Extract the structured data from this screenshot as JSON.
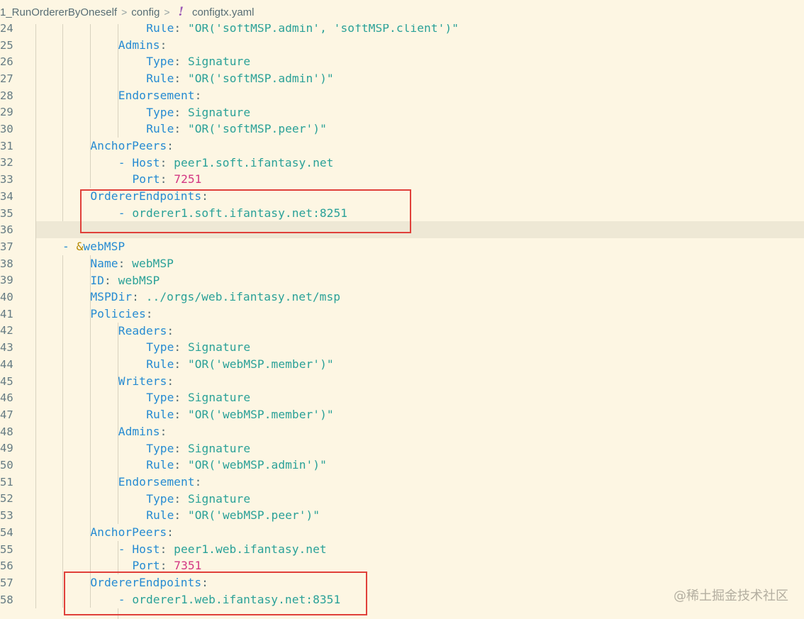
{
  "breadcrumb": {
    "folder": "1_RunOrdererByOneself",
    "subfolder": "config",
    "file_icon": "!",
    "file": "configtx.yaml"
  },
  "lines": [
    {
      "num": "24",
      "indent": 4,
      "tokens": [
        {
          "t": "k",
          "v": "Rule"
        },
        {
          "t": "p",
          "v": ": "
        },
        {
          "t": "s",
          "v": "\"OR('softMSP.admin', 'softMSP.client')\""
        }
      ]
    },
    {
      "num": "25",
      "indent": 3,
      "tokens": [
        {
          "t": "k",
          "v": "Admins"
        },
        {
          "t": "p",
          "v": ":"
        }
      ]
    },
    {
      "num": "26",
      "indent": 4,
      "tokens": [
        {
          "t": "k",
          "v": "Type"
        },
        {
          "t": "p",
          "v": ": "
        },
        {
          "t": "s",
          "v": "Signature"
        }
      ]
    },
    {
      "num": "27",
      "indent": 4,
      "tokens": [
        {
          "t": "k",
          "v": "Rule"
        },
        {
          "t": "p",
          "v": ": "
        },
        {
          "t": "s",
          "v": "\"OR('softMSP.admin')\""
        }
      ]
    },
    {
      "num": "28",
      "indent": 3,
      "tokens": [
        {
          "t": "k",
          "v": "Endorsement"
        },
        {
          "t": "p",
          "v": ":"
        }
      ]
    },
    {
      "num": "29",
      "indent": 4,
      "tokens": [
        {
          "t": "k",
          "v": "Type"
        },
        {
          "t": "p",
          "v": ": "
        },
        {
          "t": "s",
          "v": "Signature"
        }
      ]
    },
    {
      "num": "30",
      "indent": 4,
      "tokens": [
        {
          "t": "k",
          "v": "Rule"
        },
        {
          "t": "p",
          "v": ": "
        },
        {
          "t": "s",
          "v": "\"OR('softMSP.peer')\""
        }
      ]
    },
    {
      "num": "31",
      "indent": 2,
      "tokens": [
        {
          "t": "k",
          "v": "AnchorPeers"
        },
        {
          "t": "p",
          "v": ":"
        }
      ]
    },
    {
      "num": "32",
      "indent": 3,
      "tokens": [
        {
          "t": "k",
          "v": "- Host"
        },
        {
          "t": "p",
          "v": ": "
        },
        {
          "t": "s",
          "v": "peer1.soft.ifantasy.net"
        }
      ]
    },
    {
      "num": "33",
      "indent": 3.5,
      "tokens": [
        {
          "t": "k",
          "v": "Port"
        },
        {
          "t": "p",
          "v": ": "
        },
        {
          "t": "n",
          "v": "7251"
        }
      ]
    },
    {
      "num": "34",
      "indent": 2,
      "tokens": [
        {
          "t": "k",
          "v": "OrdererEndpoints"
        },
        {
          "t": "p",
          "v": ":"
        }
      ]
    },
    {
      "num": "35",
      "indent": 3,
      "tokens": [
        {
          "t": "k",
          "v": "- "
        },
        {
          "t": "s",
          "v": "orderer1.soft.ifantasy.net:8251"
        }
      ]
    },
    {
      "num": "36",
      "indent": 0,
      "tokens": []
    },
    {
      "num": "37",
      "indent": 1,
      "tokens": [
        {
          "t": "k",
          "v": "- "
        },
        {
          "t": "a",
          "v": "&"
        },
        {
          "t": "k",
          "v": "webMSP"
        }
      ]
    },
    {
      "num": "38",
      "indent": 2,
      "tokens": [
        {
          "t": "k",
          "v": "Name"
        },
        {
          "t": "p",
          "v": ": "
        },
        {
          "t": "s",
          "v": "webMSP"
        }
      ]
    },
    {
      "num": "39",
      "indent": 2,
      "tokens": [
        {
          "t": "k",
          "v": "ID"
        },
        {
          "t": "p",
          "v": ": "
        },
        {
          "t": "s",
          "v": "webMSP"
        }
      ]
    },
    {
      "num": "40",
      "indent": 2,
      "tokens": [
        {
          "t": "k",
          "v": "MSPDir"
        },
        {
          "t": "p",
          "v": ": "
        },
        {
          "t": "s",
          "v": "../orgs/web.ifantasy.net/msp"
        }
      ]
    },
    {
      "num": "41",
      "indent": 2,
      "tokens": [
        {
          "t": "k",
          "v": "Policies"
        },
        {
          "t": "p",
          "v": ":"
        }
      ]
    },
    {
      "num": "42",
      "indent": 3,
      "tokens": [
        {
          "t": "k",
          "v": "Readers"
        },
        {
          "t": "p",
          "v": ":"
        }
      ]
    },
    {
      "num": "43",
      "indent": 4,
      "tokens": [
        {
          "t": "k",
          "v": "Type"
        },
        {
          "t": "p",
          "v": ": "
        },
        {
          "t": "s",
          "v": "Signature"
        }
      ]
    },
    {
      "num": "44",
      "indent": 4,
      "tokens": [
        {
          "t": "k",
          "v": "Rule"
        },
        {
          "t": "p",
          "v": ": "
        },
        {
          "t": "s",
          "v": "\"OR('webMSP.member')\""
        }
      ]
    },
    {
      "num": "45",
      "indent": 3,
      "tokens": [
        {
          "t": "k",
          "v": "Writers"
        },
        {
          "t": "p",
          "v": ":"
        }
      ]
    },
    {
      "num": "46",
      "indent": 4,
      "tokens": [
        {
          "t": "k",
          "v": "Type"
        },
        {
          "t": "p",
          "v": ": "
        },
        {
          "t": "s",
          "v": "Signature"
        }
      ]
    },
    {
      "num": "47",
      "indent": 4,
      "tokens": [
        {
          "t": "k",
          "v": "Rule"
        },
        {
          "t": "p",
          "v": ": "
        },
        {
          "t": "s",
          "v": "\"OR('webMSP.member')\""
        }
      ]
    },
    {
      "num": "48",
      "indent": 3,
      "tokens": [
        {
          "t": "k",
          "v": "Admins"
        },
        {
          "t": "p",
          "v": ":"
        }
      ]
    },
    {
      "num": "49",
      "indent": 4,
      "tokens": [
        {
          "t": "k",
          "v": "Type"
        },
        {
          "t": "p",
          "v": ": "
        },
        {
          "t": "s",
          "v": "Signature"
        }
      ]
    },
    {
      "num": "50",
      "indent": 4,
      "tokens": [
        {
          "t": "k",
          "v": "Rule"
        },
        {
          "t": "p",
          "v": ": "
        },
        {
          "t": "s",
          "v": "\"OR('webMSP.admin')\""
        }
      ]
    },
    {
      "num": "51",
      "indent": 3,
      "tokens": [
        {
          "t": "k",
          "v": "Endorsement"
        },
        {
          "t": "p",
          "v": ":"
        }
      ]
    },
    {
      "num": "52",
      "indent": 4,
      "tokens": [
        {
          "t": "k",
          "v": "Type"
        },
        {
          "t": "p",
          "v": ": "
        },
        {
          "t": "s",
          "v": "Signature"
        }
      ]
    },
    {
      "num": "53",
      "indent": 4,
      "tokens": [
        {
          "t": "k",
          "v": "Rule"
        },
        {
          "t": "p",
          "v": ": "
        },
        {
          "t": "s",
          "v": "\"OR('webMSP.peer')\""
        }
      ]
    },
    {
      "num": "54",
      "indent": 2,
      "tokens": [
        {
          "t": "k",
          "v": "AnchorPeers"
        },
        {
          "t": "p",
          "v": ":"
        }
      ]
    },
    {
      "num": "55",
      "indent": 3,
      "tokens": [
        {
          "t": "k",
          "v": "- Host"
        },
        {
          "t": "p",
          "v": ": "
        },
        {
          "t": "s",
          "v": "peer1.web.ifantasy.net"
        }
      ]
    },
    {
      "num": "56",
      "indent": 3.5,
      "tokens": [
        {
          "t": "k",
          "v": "Port"
        },
        {
          "t": "p",
          "v": ": "
        },
        {
          "t": "n",
          "v": "7351"
        }
      ]
    },
    {
      "num": "57",
      "indent": 2,
      "tokens": [
        {
          "t": "k",
          "v": "OrdererEndpoints"
        },
        {
          "t": "p",
          "v": ":"
        }
      ]
    },
    {
      "num": "58",
      "indent": 3,
      "tokens": [
        {
          "t": "k",
          "v": "- "
        },
        {
          "t": "s",
          "v": "orderer1.web.ifantasy.net:8351"
        }
      ]
    }
  ],
  "current_line": "36",
  "annotations": {
    "box_1_lines": [
      "34",
      "35"
    ],
    "box_2_lines": [
      "57",
      "58"
    ],
    "color": "#e0403a"
  },
  "watermark": "@稀土掘金技术社区",
  "colors": {
    "background": "#fdf6e3",
    "key": "#268bd2",
    "string": "#2aa198",
    "number": "#d33682",
    "anchor": "#b58900"
  }
}
